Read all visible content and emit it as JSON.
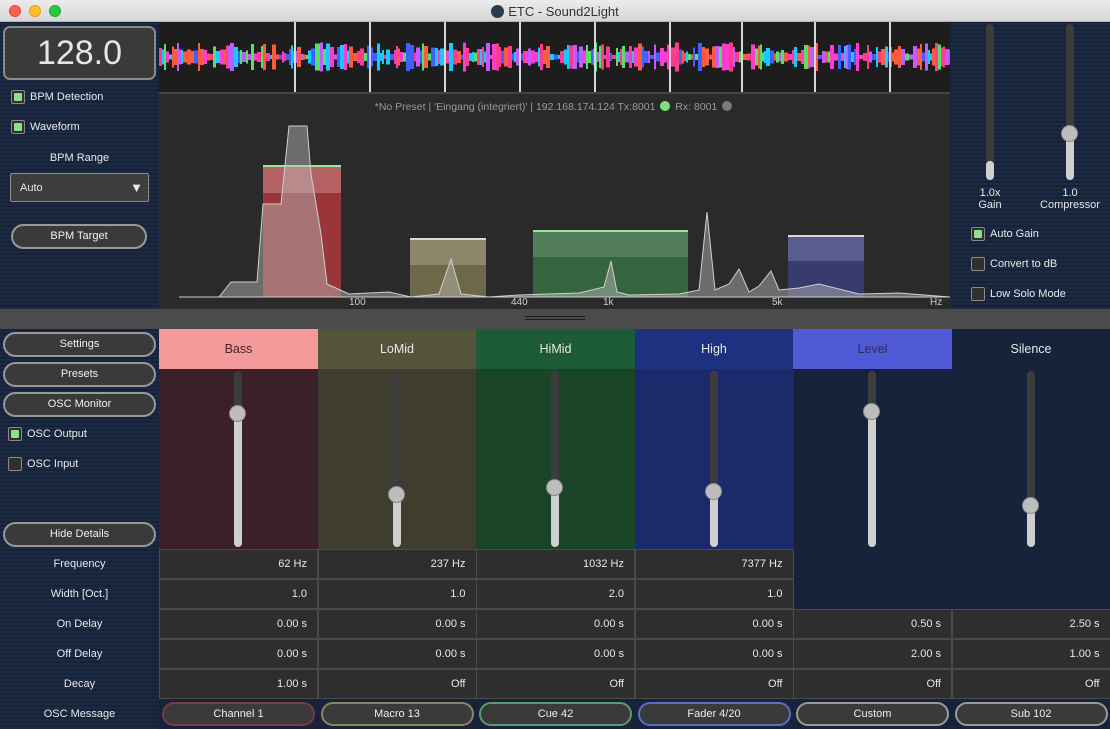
{
  "window": {
    "title": "ETC - Sound2Light"
  },
  "bpm": {
    "value": "128.0",
    "detection_label": "BPM Detection",
    "detection_checked": true,
    "waveform_label": "Waveform",
    "waveform_checked": true,
    "range_label": "BPM Range",
    "range_value": "Auto",
    "target_label": "BPM Target"
  },
  "status_bar": {
    "text": "*No Preset  |  'Eingang (integriert)'  |  192.168.174.124 Tx:8001",
    "rx_text": "Rx: 8001",
    "tx_color": "#7fe07b",
    "rx_color": "#7a7a7a"
  },
  "spectrum_axis": [
    "100",
    "440",
    "1k",
    "5k",
    "Hz"
  ],
  "controls": {
    "gain_value": "1.0x",
    "gain_label": "Gain",
    "gain_level": 0.12,
    "compressor_value": "1.0",
    "compressor_label": "Compressor",
    "compressor_level": 0.3,
    "auto_gain_label": "Auto Gain",
    "auto_gain_checked": true,
    "convert_db_label": "Convert to dB",
    "convert_db_checked": false,
    "low_solo_label": "Low Solo Mode",
    "low_solo_checked": false
  },
  "menu": {
    "settings": "Settings",
    "presets": "Presets",
    "osc_monitor": "OSC Monitor",
    "osc_output_label": "OSC Output",
    "osc_output_checked": true,
    "osc_input_label": "OSC Input",
    "osc_input_checked": false,
    "hide_details": "Hide Details"
  },
  "row_labels": {
    "frequency": "Frequency",
    "width": "Width [Oct.]",
    "on_delay": "On Delay",
    "off_delay": "Off Delay",
    "decay": "Decay",
    "osc_message": "OSC Message"
  },
  "bands": [
    {
      "name": "Bass",
      "head_color": "#f59a9a",
      "head_text": "#3b2b2b",
      "bg": "#3b1f29",
      "level": 0.76,
      "frequency": "62 Hz",
      "width": "1.0",
      "on_delay": "0.00 s",
      "off_delay": "0.00 s",
      "decay": "1.00 s",
      "osc_message": "Channel 1",
      "osc_border": "#7a3b46"
    },
    {
      "name": "LoMid",
      "head_color": "#55533a",
      "head_text": "#e8e8e8",
      "bg": "#3f3d2e",
      "level": 0.3,
      "frequency": "237 Hz",
      "width": "1.0",
      "on_delay": "0.00 s",
      "off_delay": "0.00 s",
      "decay": "Off",
      "osc_message": "Macro 13",
      "osc_border": "#8b8560"
    },
    {
      "name": "HiMid",
      "head_color": "#1d5a36",
      "head_text": "#e8e8e8",
      "bg": "#1a4428",
      "level": 0.34,
      "frequency": "1032 Hz",
      "width": "2.0",
      "on_delay": "0.00 s",
      "off_delay": "0.00 s",
      "decay": "Off",
      "osc_message": "Cue 42",
      "osc_border": "#5c9b6c"
    },
    {
      "name": "High",
      "head_color": "#1e3181",
      "head_text": "#e8e8e8",
      "bg": "#1b2a6b",
      "level": 0.32,
      "frequency": "7377 Hz",
      "width": "1.0",
      "on_delay": "0.00 s",
      "off_delay": "0.00 s",
      "decay": "Off",
      "osc_message": "Fader 4/20",
      "osc_border": "#5a6fc0"
    },
    {
      "name": "Level",
      "head_color": "#5059d6",
      "head_text": "#2c2c5a",
      "bg": "transparent",
      "level": 0.77,
      "frequency": "",
      "width": "",
      "on_delay": "0.50 s",
      "off_delay": "2.00 s",
      "decay": "Off",
      "osc_message": "Custom",
      "osc_border": "#9a9a9a"
    },
    {
      "name": "Silence",
      "head_color": "transparent",
      "head_text": "#e8e8e8",
      "bg": "transparent",
      "level": 0.24,
      "frequency": "",
      "width": "",
      "on_delay": "2.50 s",
      "off_delay": "1.00 s",
      "decay": "Off",
      "osc_message": "Sub 102",
      "osc_border": "#9a9a9a"
    }
  ]
}
